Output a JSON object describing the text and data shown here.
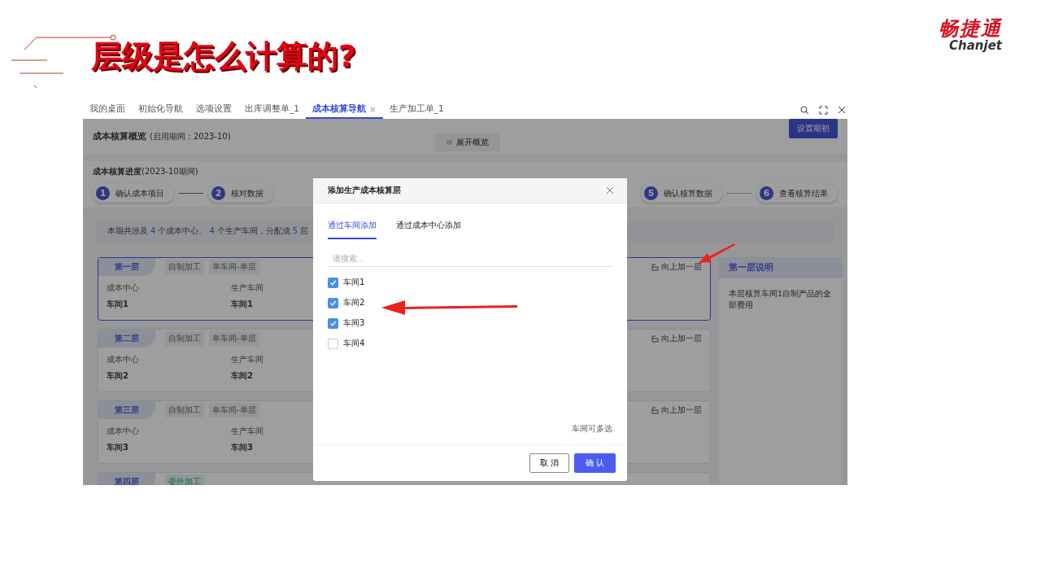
{
  "slide": {
    "title": "层级是怎么计算的?",
    "logo": {
      "name": "畅捷通",
      "latin": "Chanjet"
    }
  },
  "tabs": [
    {
      "label": "我的桌面",
      "selected": false
    },
    {
      "label": "初始化导航",
      "selected": false
    },
    {
      "label": "选项设置",
      "selected": false
    },
    {
      "label": "出库调整单_1",
      "selected": false
    },
    {
      "label": "成本核算导航",
      "selected": true,
      "close": "×"
    },
    {
      "label": "生产加工单_1",
      "selected": false
    }
  ],
  "overview": {
    "title": "成本核算概览",
    "period": "(启用期间：2023-10)",
    "expand_button": "展开概览",
    "setup_button": "设置期初"
  },
  "progress": {
    "title": "成本核算进度",
    "period": "(2023-10期间)",
    "steps_left": [
      {
        "number": "1",
        "label": "确认成本项目",
        "connector": {
          "kind": "solid"
        }
      },
      {
        "number": "2",
        "label": "核对数据"
      }
    ],
    "steps_right": [
      {
        "number": "5",
        "label": "确认核算数据",
        "connector": {
          "kind": "dotted"
        }
      },
      {
        "number": "6",
        "label": "查看核算结果"
      }
    ]
  },
  "summary": [
    {
      "kind": "text",
      "text": "本期共涉及"
    },
    {
      "kind": "number",
      "text": "4"
    },
    {
      "kind": "text",
      "text": "个成本中心、"
    },
    {
      "kind": "number",
      "text": "4"
    },
    {
      "kind": "text",
      "text": "个生产车间，分配成"
    },
    {
      "kind": "number",
      "text": "5"
    },
    {
      "kind": "text",
      "text": "层"
    }
  ],
  "layers": [
    {
      "title": "第一层",
      "selected": true,
      "tags": [
        {
          "label": "自制加工",
          "kind": "self"
        },
        {
          "label": "单车间-单层",
          "kind": "self"
        }
      ],
      "cost_center_label": "成本中心",
      "cost_center": "车间1",
      "workshop_label": "生产车间",
      "workshop": "车间1",
      "action": "向上加一层"
    },
    {
      "title": "第二层",
      "selected": false,
      "tags": [
        {
          "label": "自制加工",
          "kind": "self"
        },
        {
          "label": "单车间-单层",
          "kind": "self"
        }
      ],
      "cost_center_label": "成本中心",
      "cost_center": "车间2",
      "workshop_label": "生产车间",
      "workshop": "车间2",
      "action": "向上加一层"
    },
    {
      "title": "第三层",
      "selected": false,
      "tags": [
        {
          "label": "自制加工",
          "kind": "self"
        },
        {
          "label": "单车间-单层",
          "kind": "self"
        }
      ],
      "cost_center_label": "成本中心",
      "cost_center": "车间3",
      "workshop_label": "生产车间",
      "workshop": "车间3",
      "action": "向上加一层"
    },
    {
      "title": "第四层",
      "selected": false,
      "tags": [
        {
          "label": "委外加工",
          "kind": "outsourced"
        }
      ]
    }
  ],
  "layer_note": {
    "title": "第一层说明",
    "text": "本层核算车间1自制产品的全部费用"
  },
  "dialog": {
    "title": "添加生产成本核算层",
    "tabs": [
      {
        "label": "通过车间添加",
        "selected": true
      },
      {
        "label": "通过成本中心添加",
        "selected": false
      }
    ],
    "search": {
      "placeholder": "请搜索..."
    },
    "options": [
      {
        "label": "车间1",
        "checked": true
      },
      {
        "label": "车间2",
        "checked": true
      },
      {
        "label": "车间3",
        "checked": true
      },
      {
        "label": "车间4",
        "checked": false
      }
    ],
    "hint": "车间可多选",
    "cancel_button": "取 消",
    "confirm_button": "确 认"
  }
}
